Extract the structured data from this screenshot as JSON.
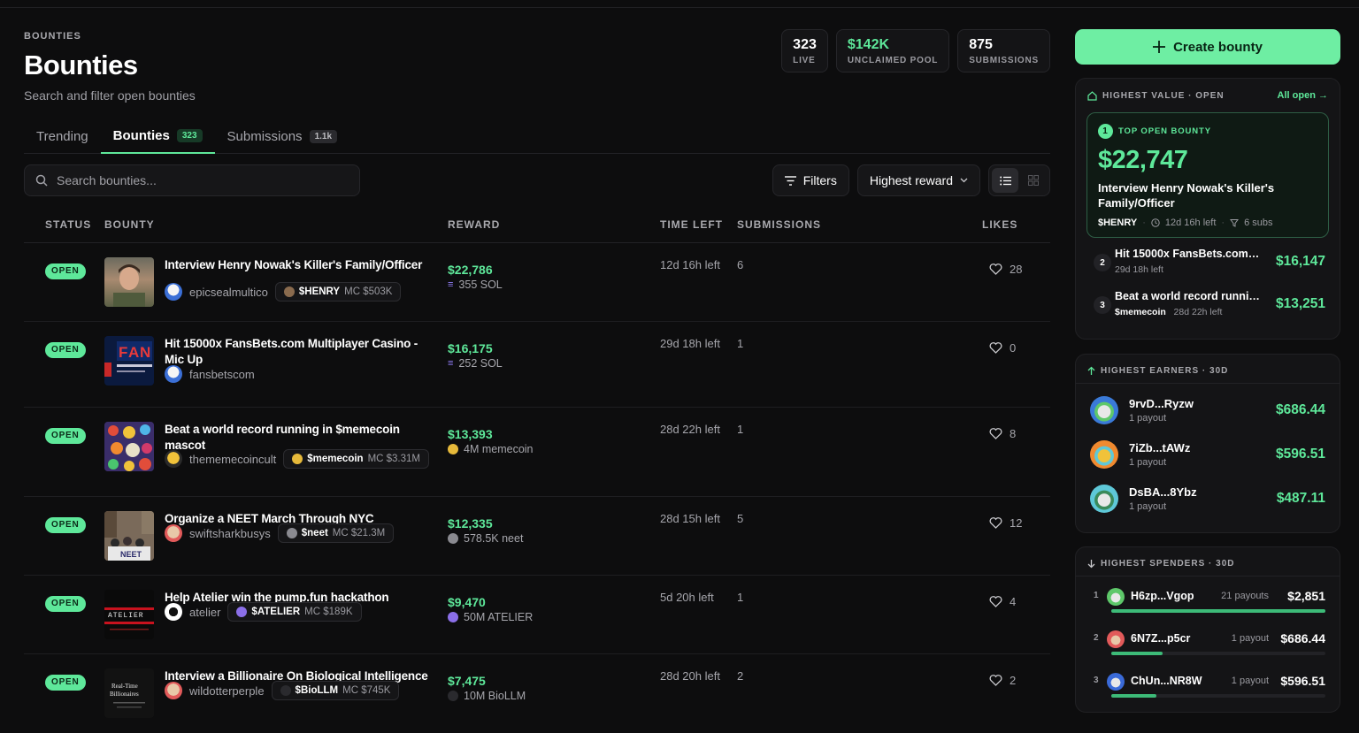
{
  "header": {
    "eyebrow": "BOUNTIES",
    "title": "Bounties",
    "subtitle": "Search and filter open bounties"
  },
  "stats": [
    {
      "value": "323",
      "label": "LIVE"
    },
    {
      "value": "$142K",
      "label": "UNCLAIMED POOL"
    },
    {
      "value": "875",
      "label": "SUBMISSIONS"
    }
  ],
  "tabs": [
    {
      "label": "Trending",
      "count": ""
    },
    {
      "label": "Bounties",
      "count": "323"
    },
    {
      "label": "Submissions",
      "count": "1.1k"
    }
  ],
  "search": {
    "placeholder": "Search bounties..."
  },
  "controls": {
    "filters": "Filters",
    "sort": "Highest reward"
  },
  "columns": {
    "status": "STATUS",
    "bounty": "BOUNTY",
    "reward": "REWARD",
    "time_left": "TIME LEFT",
    "submissions": "SUBMISSIONS",
    "likes": "LIKES"
  },
  "rows": [
    {
      "status": "OPEN",
      "title": "Interview Henry Nowak's Killer's Family/Officer",
      "handle": "epicsealmultico",
      "token": "$HENRY",
      "mc": "MC $503K",
      "reward": "$22,786",
      "reward_sub": "355 SOL",
      "time_left": "12d 16h left",
      "submissions": "6",
      "likes": "28"
    },
    {
      "status": "OPEN",
      "title": "Hit 15000x FansBets.com Multiplayer Casino - Mic Up",
      "handle": "fansbetscom",
      "token": "",
      "mc": "",
      "reward": "$16,175",
      "reward_sub": "252 SOL",
      "time_left": "29d 18h left",
      "submissions": "1",
      "likes": "0"
    },
    {
      "status": "OPEN",
      "title": "Beat a world record running in $memecoin mascot",
      "handle": "thememecoincult",
      "token": "$memecoin",
      "mc": "MC $3.31M",
      "reward": "$13,393",
      "reward_sub": "4M memecoin",
      "time_left": "28d 22h left",
      "submissions": "1",
      "likes": "8"
    },
    {
      "status": "OPEN",
      "title": "Organize a NEET March Through NYC",
      "handle": "swiftsharkbusys",
      "token": "$neet",
      "mc": "MC $21.3M",
      "reward": "$12,335",
      "reward_sub": "578.5K neet",
      "time_left": "28d 15h left",
      "submissions": "5",
      "likes": "12"
    },
    {
      "status": "OPEN",
      "title": "Help Atelier win the pump.fun hackathon",
      "handle": "atelier",
      "token": "$ATELIER",
      "mc": "MC $189K",
      "reward": "$9,470",
      "reward_sub": "50M ATELIER",
      "time_left": "5d 20h left",
      "submissions": "1",
      "likes": "4"
    },
    {
      "status": "OPEN",
      "title": "Interview a Billionaire On Biological Intelligence",
      "handle": "wildotterperple",
      "token": "$BioLLM",
      "mc": "MC $745K",
      "reward": "$7,475",
      "reward_sub": "10M BioLLM",
      "time_left": "28d 20h left",
      "submissions": "2",
      "likes": "2"
    }
  ],
  "sidebar": {
    "create_label": "Create bounty",
    "highest_value": {
      "title": "HIGHEST VALUE · OPEN",
      "link": "All open →",
      "top": {
        "rank": "1",
        "label": "TOP OPEN BOUNTY",
        "amount": "$22,747",
        "title": "Interview Henry Nowak's Killer's Family/Officer",
        "token": "$HENRY",
        "time": "12d 16h left",
        "subs": "6 subs"
      },
      "others": [
        {
          "rank": "2",
          "title": "Hit 15000x FansBets.com Multiplayer Casino - Mic Up",
          "token": "",
          "time": "29d 18h left",
          "amount": "$16,147"
        },
        {
          "rank": "3",
          "title": "Beat a world record running in $memecoin mascot",
          "token": "$memecoin",
          "time": "28d 22h left",
          "amount": "$13,251"
        }
      ]
    },
    "earners": {
      "title": "HIGHEST EARNERS · 30D",
      "items": [
        {
          "name": "9rvD...Ryzw",
          "payouts": "1 payout",
          "amount": "$686.44"
        },
        {
          "name": "7iZb...tAWz",
          "payouts": "1 payout",
          "amount": "$596.51"
        },
        {
          "name": "DsBA...8Ybz",
          "payouts": "1 payout",
          "amount": "$487.11"
        }
      ]
    },
    "spenders": {
      "title": "HIGHEST SPENDERS · 30D",
      "items": [
        {
          "rank": "1",
          "name": "H6zp...Vgop",
          "payouts": "21 payouts",
          "amount": "$2,851",
          "share": 1.0
        },
        {
          "rank": "2",
          "name": "6N7Z...p5cr",
          "payouts": "1 payout",
          "amount": "$686.44",
          "share": 0.24
        },
        {
          "rank": "3",
          "name": "ChUn...NR8W",
          "payouts": "1 payout",
          "amount": "$596.51",
          "share": 0.21
        }
      ]
    }
  }
}
